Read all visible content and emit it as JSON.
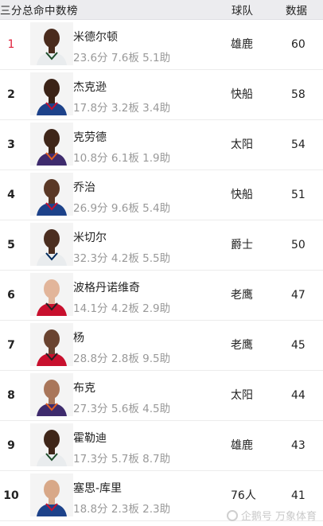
{
  "header": {
    "title": "三分总命中数榜",
    "team_col": "球队",
    "value_col": "数据"
  },
  "rows": [
    {
      "rank": "1",
      "name": "米德尔顿",
      "stats": "23.6分 7.6板 5.1助",
      "team": "雄鹿",
      "value": "60",
      "skin": "#4a2b1d",
      "jersey": "#e9ecee",
      "trim": "#1e4d2b"
    },
    {
      "rank": "2",
      "name": "杰克逊",
      "stats": "17.8分 3.2板 3.4助",
      "team": "快船",
      "value": "58",
      "skin": "#3b2317",
      "jersey": "#1d428a",
      "trim": "#c8102e"
    },
    {
      "rank": "3",
      "name": "克劳德",
      "stats": "10.8分 6.1板 1.9助",
      "team": "太阳",
      "value": "54",
      "skin": "#3f2619",
      "jersey": "#3e2b6d",
      "trim": "#e56020"
    },
    {
      "rank": "4",
      "name": "乔治",
      "stats": "26.9分 9.6板 5.4助",
      "team": "快船",
      "value": "51",
      "skin": "#5a3826",
      "jersey": "#1d428a",
      "trim": "#c8102e"
    },
    {
      "rank": "5",
      "name": "米切尔",
      "stats": "32.3分 4.2板 5.5助",
      "team": "爵士",
      "value": "50",
      "skin": "#4b2e20",
      "jersey": "#e9ecee",
      "trim": "#002b5c"
    },
    {
      "rank": "6",
      "name": "波格丹诺维奇",
      "stats": "14.1分 4.2板 2.9助",
      "team": "老鹰",
      "value": "47",
      "skin": "#e2b59a",
      "jersey": "#c8102e",
      "trim": "#222222"
    },
    {
      "rank": "7",
      "name": "杨",
      "stats": "28.8分 2.8板 9.5助",
      "team": "老鹰",
      "value": "45",
      "skin": "#6a4330",
      "jersey": "#c8102e",
      "trim": "#222222"
    },
    {
      "rank": "8",
      "name": "布克",
      "stats": "27.3分 5.6板 4.5助",
      "team": "太阳",
      "value": "44",
      "skin": "#a9765a",
      "jersey": "#3e2b6d",
      "trim": "#e56020"
    },
    {
      "rank": "9",
      "name": "霍勒迪",
      "stats": "17.3分 5.7板 8.7助",
      "team": "雄鹿",
      "value": "43",
      "skin": "#3f2619",
      "jersey": "#e9ecee",
      "trim": "#1e4d2b"
    },
    {
      "rank": "10",
      "name": "塞思-库里",
      "stats": "18.8分 2.3板 2.3助",
      "team": "76人",
      "value": "41",
      "skin": "#d8a888",
      "jersey": "#1d428a",
      "trim": "#c8102e"
    }
  ],
  "watermark": "企鹅号 万象体育",
  "colors": {
    "top_rank": "#e0213b",
    "stats": "#999999",
    "header_bg": "#ececef"
  }
}
